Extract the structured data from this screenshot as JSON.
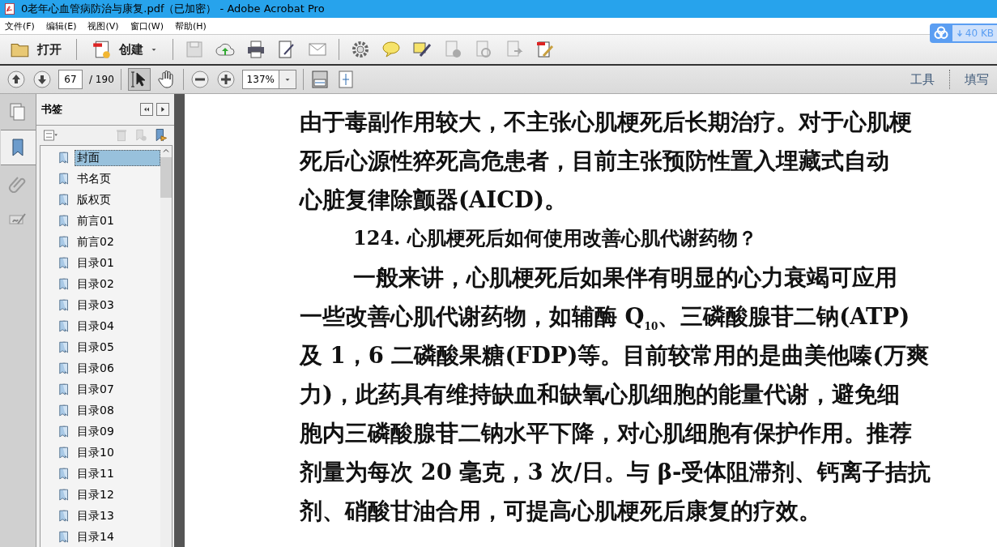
{
  "window": {
    "title": "0老年心血管病防治与康复.pdf（已加密） - Adobe Acrobat Pro"
  },
  "menu": [
    "文件(F)",
    "编辑(E)",
    "视图(V)",
    "窗口(W)",
    "帮助(H)"
  ],
  "toolbar": {
    "open_label": "打开",
    "create_label": "创建"
  },
  "download_widget": {
    "size": "40 KB"
  },
  "nav_toolbar": {
    "page": "67",
    "page_total": "/ 190",
    "zoom": "137%",
    "select_tool_selected": true,
    "tabs": [
      "工具",
      "填写"
    ]
  },
  "side_tabs": [
    {
      "kind": "pages",
      "selected": false
    },
    {
      "kind": "bookmarks",
      "selected": true
    },
    {
      "kind": "attachments",
      "selected": false
    },
    {
      "kind": "signatures",
      "selected": false
    }
  ],
  "bookmarks": {
    "title": "书签",
    "items": [
      {
        "label": "封面",
        "selected": true
      },
      {
        "label": "书名页",
        "selected": false
      },
      {
        "label": "版权页",
        "selected": false
      },
      {
        "label": "前言01",
        "selected": false
      },
      {
        "label": "前言02",
        "selected": false
      },
      {
        "label": "目录01",
        "selected": false
      },
      {
        "label": "目录02",
        "selected": false
      },
      {
        "label": "目录03",
        "selected": false
      },
      {
        "label": "目录04",
        "selected": false
      },
      {
        "label": "目录05",
        "selected": false
      },
      {
        "label": "目录06",
        "selected": false
      },
      {
        "label": "目录07",
        "selected": false
      },
      {
        "label": "目录08",
        "selected": false
      },
      {
        "label": "目录09",
        "selected": false
      },
      {
        "label": "目录10",
        "selected": false
      },
      {
        "label": "目录11",
        "selected": false
      },
      {
        "label": "目录12",
        "selected": false
      },
      {
        "label": "目录13",
        "selected": false
      },
      {
        "label": "目录14",
        "selected": false
      }
    ]
  },
  "document": {
    "lines": [
      {
        "kind": "body",
        "text": "由于毒副作用较大，不主张心肌梗死后长期治疗。对于心肌梗"
      },
      {
        "kind": "body",
        "text": "死后心源性猝死高危患者，目前主张预防性置入埋藏式自动"
      },
      {
        "kind": "body",
        "text": "心脏复律除颤器(AICD)。"
      },
      {
        "kind": "heading",
        "text": "124. 心肌梗死后如何使用改善心肌代谢药物？"
      },
      {
        "kind": "indent",
        "text": "一般来讲，心肌梗死后如果伴有明显的心力衰竭可应用"
      },
      {
        "kind": "body",
        "text": "一些改善心肌代谢药物，如辅酶 Q$_{10}$、三磷酸腺苷二钠(ATP)"
      },
      {
        "kind": "body",
        "text": "及 1，6 二磷酸果糖(FDP)等。目前较常用的是曲美他嗪(万爽"
      },
      {
        "kind": "body",
        "text": "力)，此药具有维持缺血和缺氧心肌细胞的能量代谢，避免细"
      },
      {
        "kind": "body",
        "text": "胞内三磷酸腺苷二钠水平下降，对心肌细胞有保护作用。推荐"
      },
      {
        "kind": "body",
        "text": "剂量为每次 20 毫克，3 次/日。与 β-受体阻滞剂、钙离子拮抗"
      },
      {
        "kind": "body",
        "text": "剂、硝酸甘油合用，可提高心肌梗死后康复的疗效。"
      }
    ]
  }
}
